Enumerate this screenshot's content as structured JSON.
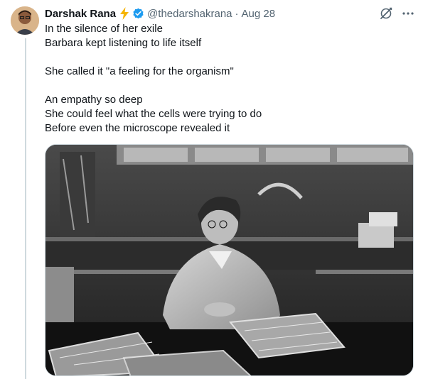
{
  "author": {
    "name": "Darshak Rana",
    "handle": "@thedarshakrana",
    "date": "Aug 28",
    "verified": true,
    "bolt_icon": "lightning-bolt-emoji",
    "colors": {
      "verified": "#1d9bf0",
      "bolt": "#f5b400"
    }
  },
  "tweet": {
    "lines": [
      "In the silence of her exile",
      "Barbara kept listening to life itself",
      "",
      "She called it \"a feeling for the organism\"",
      "",
      "An empathy so deep",
      "She could feel what the cells were trying to do",
      "Before even the microscope revealed it"
    ]
  },
  "media": {
    "type": "black-and-white photograph"
  },
  "actions": {
    "grok_icon": "grok-icon",
    "more_icon": "more-icon"
  }
}
